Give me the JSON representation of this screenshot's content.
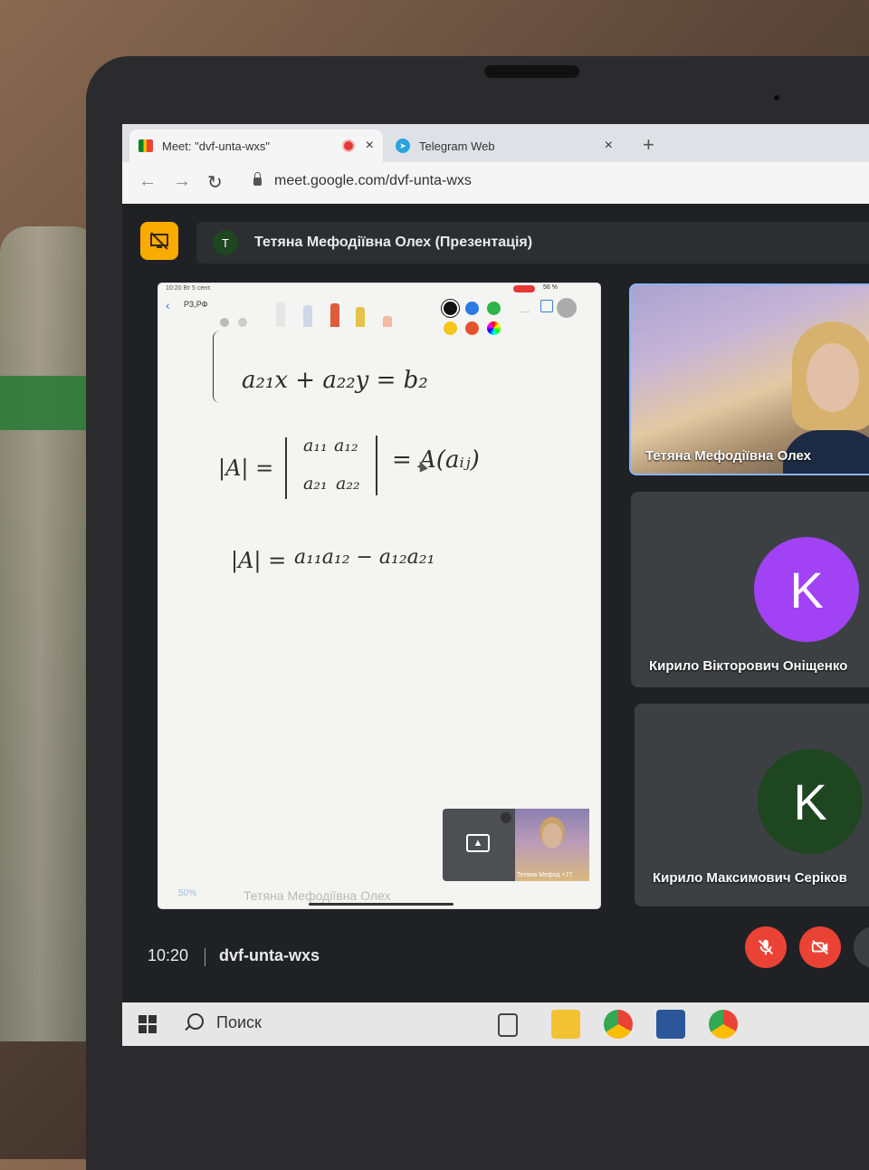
{
  "browser": {
    "tabs": [
      {
        "title": "Meet: \"dvf-unta-wxs\"",
        "icon": "meet-icon",
        "recording": true
      },
      {
        "title": "Telegram Web",
        "icon": "telegram-icon"
      }
    ],
    "close_glyph": "×",
    "new_tab_glyph": "+",
    "url": "meet.google.com/dvf-unta-wxs"
  },
  "meet": {
    "presenter": {
      "initial": "T",
      "title": "Тетяна Мефодіївна Олех (Презентація)"
    },
    "ipad": {
      "status_time": "10:20  Вт 5 сент.",
      "battery": "56 %",
      "doc_name": "РЗ,РФ",
      "more": "···"
    },
    "board": {
      "line1": "a₂₁x + a₂₂y = b₂",
      "det_lhs": "|A| =",
      "m11": "a₁₁",
      "m12": "a₁₂",
      "m21": "a₂₁",
      "m22": "a₂₂",
      "det_rhs": "= A(aᵢⱼ)",
      "line3_lhs": "|A| =",
      "line3_rhs": "a₁₁a₁₂ − a₁₂a₂₁"
    },
    "self_view": {
      "name": "Тетяна Мефод +77",
      "present_glyph": "▲"
    },
    "faded_name": "Тетяна Мефодіївна Олех",
    "faded_zoom": "50%",
    "participants": [
      {
        "name": "Тетяна Мефодіївна Олех",
        "type": "video"
      },
      {
        "name": "Кирило Вікторович Оніщенко",
        "initial": "K",
        "color": "#a142f4"
      },
      {
        "name": "Кирило Максимович Серіков",
        "initial": "K",
        "color": "#1e4620"
      }
    ],
    "time": "10:20",
    "meeting_code": "dvf-unta-wxs",
    "colors": {
      "danger": "#ea4335",
      "accent": "#8ab4f8",
      "presenting": "#f9ab00"
    }
  },
  "taskbar": {
    "search_label": "Поиск",
    "apps": [
      "task-view-icon",
      "file-explorer-icon",
      "chrome-icon",
      "word-icon",
      "chrome-profile-icon"
    ]
  }
}
